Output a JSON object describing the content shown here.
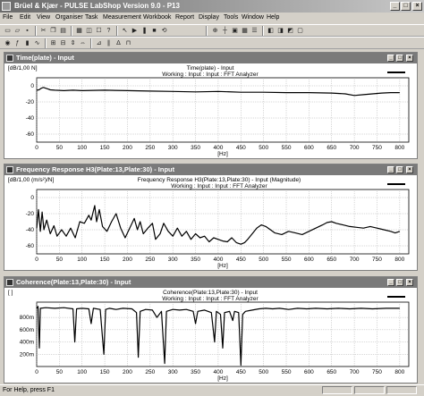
{
  "window": {
    "title": "Brüel & Kjær - PULSE LabShop Version 9.0 - P13"
  },
  "menu": [
    "File",
    "Edit",
    "View",
    "Organiser",
    "Task",
    "Measurement",
    "Workbook",
    "Report",
    "Display",
    "Tools",
    "Window",
    "Help"
  ],
  "toolbar_icons": [
    "new-icon",
    "open-icon",
    "save-icon",
    "cut-icon",
    "copy-icon",
    "paste-icon",
    "print-icon",
    "print-preview-icon",
    "properties-icon",
    "help-icon",
    "pointer-icon",
    "start-icon",
    "pause-icon",
    "stop-icon",
    "reset-icon",
    "proceed-icon",
    "zoom-icon",
    "cursor-icon",
    "display-icon",
    "grid-icon",
    "table-icon",
    "layout-icon",
    "tile-icon",
    "cascade-icon"
  ],
  "panels": [
    {
      "title": "Time(plate) - Input",
      "unit": "[dB/1,00 N]",
      "function": "Time(plate) - Input",
      "info": "Working : Input : Input : FFT Analyzer",
      "y_ticks": [
        "0",
        "-20",
        "-40",
        "-60"
      ],
      "y_range": [
        -70,
        10
      ],
      "curve": [
        [
          0,
          -5.5
        ],
        [
          5,
          -5
        ],
        [
          10,
          -3
        ],
        [
          15,
          -2
        ],
        [
          20,
          -3
        ],
        [
          25,
          -4
        ],
        [
          30,
          -5
        ],
        [
          40,
          -5.5
        ],
        [
          60,
          -6
        ],
        [
          80,
          -5.5
        ],
        [
          100,
          -6
        ],
        [
          150,
          -5.5
        ],
        [
          200,
          -6
        ],
        [
          250,
          -6.5
        ],
        [
          300,
          -7
        ],
        [
          350,
          -7.5
        ],
        [
          400,
          -7
        ],
        [
          450,
          -8
        ],
        [
          500,
          -8
        ],
        [
          550,
          -8.5
        ],
        [
          600,
          -8.5
        ],
        [
          650,
          -9
        ],
        [
          680,
          -10
        ],
        [
          700,
          -12
        ],
        [
          720,
          -11
        ],
        [
          740,
          -10
        ],
        [
          760,
          -9
        ],
        [
          780,
          -8.5
        ],
        [
          800,
          -8.5
        ]
      ]
    },
    {
      "title": "Frequency Response H3(Plate:13,Plate:30) - Input",
      "unit": "[dB/1,00 (m/s²)/N]",
      "function": "Frequency Response H3(Plate:13,Plate:30) - Input (Magnitude)",
      "info": "Working : Input : Input : FFT Analyzer",
      "y_ticks": [
        "0",
        "-20",
        "-40",
        "-60"
      ],
      "y_range": [
        -70,
        10
      ],
      "curve": [
        [
          0,
          -38
        ],
        [
          4,
          -15
        ],
        [
          8,
          -42
        ],
        [
          12,
          -18
        ],
        [
          16,
          -40
        ],
        [
          22,
          -28
        ],
        [
          30,
          -45
        ],
        [
          38,
          -35
        ],
        [
          45,
          -48
        ],
        [
          55,
          -40
        ],
        [
          65,
          -48
        ],
        [
          75,
          -38
        ],
        [
          85,
          -50
        ],
        [
          95,
          -30
        ],
        [
          105,
          -32
        ],
        [
          115,
          -22
        ],
        [
          120,
          -28
        ],
        [
          128,
          -10
        ],
        [
          132,
          -30
        ],
        [
          138,
          -15
        ],
        [
          145,
          -36
        ],
        [
          155,
          -42
        ],
        [
          165,
          -30
        ],
        [
          175,
          -20
        ],
        [
          185,
          -38
        ],
        [
          195,
          -50
        ],
        [
          205,
          -38
        ],
        [
          215,
          -26
        ],
        [
          222,
          -40
        ],
        [
          228,
          -30
        ],
        [
          235,
          -45
        ],
        [
          245,
          -38
        ],
        [
          255,
          -32
        ],
        [
          262,
          -52
        ],
        [
          272,
          -45
        ],
        [
          280,
          -32
        ],
        [
          290,
          -42
        ],
        [
          300,
          -48
        ],
        [
          310,
          -38
        ],
        [
          320,
          -48
        ],
        [
          330,
          -42
        ],
        [
          340,
          -52
        ],
        [
          350,
          -45
        ],
        [
          360,
          -50
        ],
        [
          370,
          -48
        ],
        [
          380,
          -55
        ],
        [
          390,
          -50
        ],
        [
          400,
          -52
        ],
        [
          410,
          -54
        ],
        [
          420,
          -55
        ],
        [
          430,
          -50
        ],
        [
          440,
          -56
        ],
        [
          450,
          -58
        ],
        [
          458,
          -56
        ],
        [
          465,
          -52
        ],
        [
          475,
          -45
        ],
        [
          485,
          -38
        ],
        [
          495,
          -34
        ],
        [
          505,
          -36
        ],
        [
          515,
          -40
        ],
        [
          525,
          -44
        ],
        [
          540,
          -46
        ],
        [
          555,
          -42
        ],
        [
          570,
          -44
        ],
        [
          585,
          -46
        ],
        [
          600,
          -42
        ],
        [
          615,
          -38
        ],
        [
          630,
          -34
        ],
        [
          640,
          -31
        ],
        [
          650,
          -30
        ],
        [
          660,
          -32
        ],
        [
          675,
          -34
        ],
        [
          690,
          -36
        ],
        [
          705,
          -37
        ],
        [
          720,
          -38
        ],
        [
          735,
          -36
        ],
        [
          750,
          -38
        ],
        [
          765,
          -40
        ],
        [
          780,
          -42
        ],
        [
          790,
          -44
        ],
        [
          800,
          -42
        ]
      ]
    },
    {
      "title": "Coherence(Plate:13,Plate:30) - Input",
      "unit": "[ ]",
      "function": "Coherence(Plate:13,Plate:30) - Input",
      "info": "Working : Input : Input : FFT Analyzer",
      "y_ticks": [
        "800m",
        "600m",
        "400m",
        "200m"
      ],
      "y_range": [
        0,
        1.05
      ],
      "curve": [
        [
          0,
          0.95
        ],
        [
          3,
          0.98
        ],
        [
          6,
          0.3
        ],
        [
          8,
          0.95
        ],
        [
          20,
          0.96
        ],
        [
          40,
          0.95
        ],
        [
          60,
          0.96
        ],
        [
          80,
          0.94
        ],
        [
          84,
          0.4
        ],
        [
          88,
          0.94
        ],
        [
          100,
          0.95
        ],
        [
          115,
          0.94
        ],
        [
          120,
          0.7
        ],
        [
          125,
          0.95
        ],
        [
          140,
          0.93
        ],
        [
          148,
          0.2
        ],
        [
          152,
          0.93
        ],
        [
          160,
          0.95
        ],
        [
          175,
          0.93
        ],
        [
          190,
          0.95
        ],
        [
          210,
          0.94
        ],
        [
          220,
          0.88
        ],
        [
          224,
          0.15
        ],
        [
          228,
          0.9
        ],
        [
          240,
          0.93
        ],
        [
          255,
          0.92
        ],
        [
          265,
          0.8
        ],
        [
          275,
          0.9
        ],
        [
          282,
          0.05
        ],
        [
          286,
          0.9
        ],
        [
          300,
          0.93
        ],
        [
          315,
          0.92
        ],
        [
          330,
          0.93
        ],
        [
          345,
          0.9
        ],
        [
          350,
          0.7
        ],
        [
          355,
          0.9
        ],
        [
          370,
          0.92
        ],
        [
          385,
          0.88
        ],
        [
          392,
          0.4
        ],
        [
          396,
          0.9
        ],
        [
          405,
          0.85
        ],
        [
          410,
          0.3
        ],
        [
          414,
          0.88
        ],
        [
          425,
          0.9
        ],
        [
          432,
          0.75
        ],
        [
          436,
          0.9
        ],
        [
          445,
          0.88
        ],
        [
          450,
          0.02
        ],
        [
          454,
          0.85
        ],
        [
          460,
          0.9
        ],
        [
          475,
          0.92
        ],
        [
          490,
          0.94
        ],
        [
          505,
          0.95
        ],
        [
          520,
          0.94
        ],
        [
          535,
          0.95
        ],
        [
          555,
          0.93
        ],
        [
          575,
          0.95
        ],
        [
          595,
          0.94
        ],
        [
          615,
          0.95
        ],
        [
          640,
          0.94
        ],
        [
          665,
          0.95
        ],
        [
          690,
          0.94
        ],
        [
          715,
          0.95
        ],
        [
          740,
          0.94
        ],
        [
          770,
          0.95
        ],
        [
          800,
          0.95
        ]
      ]
    }
  ],
  "x_ticks": [
    "0",
    "50",
    "100",
    "150",
    "200",
    "250",
    "300",
    "350",
    "400",
    "450",
    "500",
    "550",
    "600",
    "650",
    "700",
    "750",
    "800"
  ],
  "x_unit": "[Hz]",
  "status": "For Help, press F1"
}
